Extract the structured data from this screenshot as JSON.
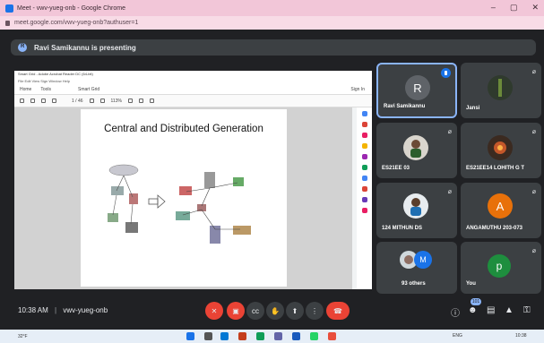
{
  "browser": {
    "title": "Meet - vwv-yueg-onb - Google Chrome",
    "url": "meet.google.com/vwv-yueg-onb?authuser=1",
    "controls": [
      "–",
      "▢",
      "✕"
    ]
  },
  "meet": {
    "presenting_text": "Ravi Samikannu is presenting",
    "time": "10:38 AM",
    "meeting_code": "vwv-yueg-onb",
    "participant_badge": "101"
  },
  "acrobat": {
    "title_bar": "Smart Grid - Adobe Acrobat Reader DC (64-bit)",
    "menu": "File  Edit  View  Sign  Window  Help",
    "tabs": [
      "Home",
      "Tools",
      "Smart Grid"
    ],
    "sign_in": "Sign In",
    "zoom": "113%",
    "page_info": "1 / 46",
    "slide_title": "Central and Distributed Generation"
  },
  "participants": [
    {
      "name": "Ravi Samikannu",
      "initial": "R",
      "color": "#5f6368",
      "speaking": true
    },
    {
      "name": "Jansi",
      "initial": "",
      "color": "#2f3a2d"
    },
    {
      "name": "ES21EE 03",
      "initial": "",
      "color": "#4a4a4a"
    },
    {
      "name": "ES21EE14 LOHITH G T",
      "initial": "",
      "color": "#3b2a20"
    },
    {
      "name": "124 MITHUN DS",
      "initial": "",
      "color": "#3a4b55"
    },
    {
      "name": "ANGAMUTHU 203-073",
      "initial": "A",
      "color": "#e8710a"
    },
    {
      "name": "93 others",
      "initial": "M",
      "color": "#1a73e8"
    },
    {
      "name": "You",
      "initial": "p",
      "color": "#1e8e3e"
    }
  ],
  "taskbar": {
    "weather": "32°F",
    "lang": "ENG",
    "clock": "10:38"
  }
}
